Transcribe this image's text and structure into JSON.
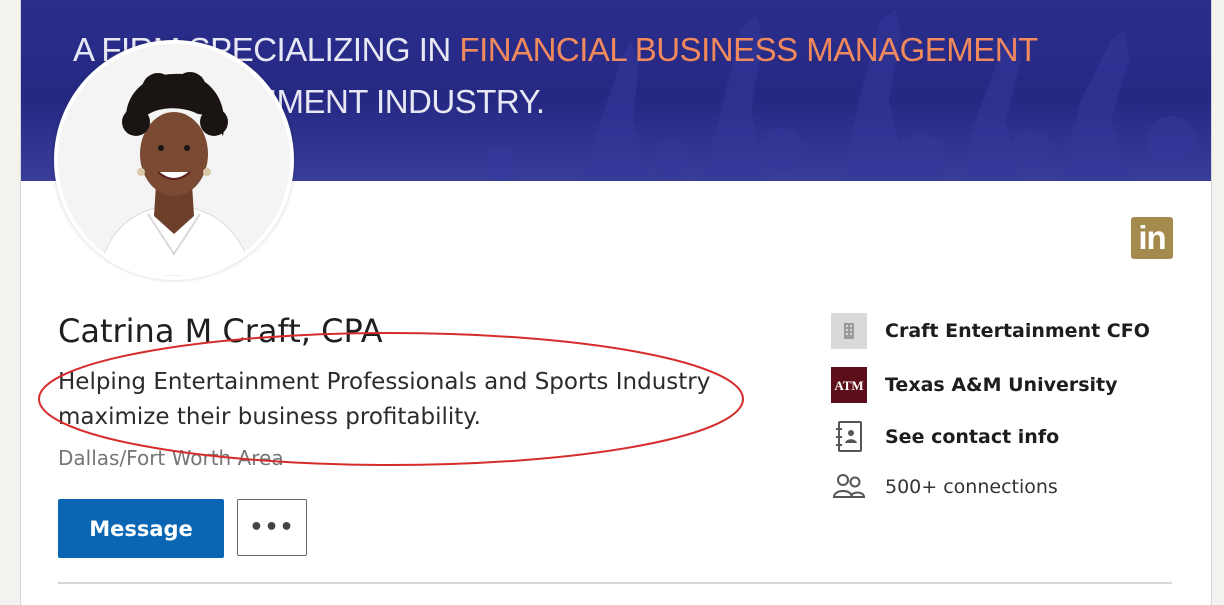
{
  "banner": {
    "line1_prefix": "A FIRM SPECIALIZING IN ",
    "line1_highlight": "FINANCIAL BUSINESS MANAGEMENT",
    "line2": "ENTERTAINMENT INDUSTRY.",
    "text_color": "#e8e8f4",
    "highlight_color": "#f08a5d",
    "background": "#2a2d8a"
  },
  "profile": {
    "name": "Catrina M Craft, CPA",
    "headline": "Helping Entertainment Professionals and Sports Industry maximize their business profitability.",
    "location": "Dallas/Fort Worth Area"
  },
  "actions": {
    "message_label": "Message",
    "more_label": "•••"
  },
  "sidebar": {
    "company": "Craft Entertainment CFO",
    "school": "Texas A&M University",
    "contact": "See contact info",
    "connections": "500+ connections"
  },
  "linkedin_badge": {
    "label": "in",
    "color": "#a48a4c"
  },
  "colors": {
    "primary_button": "#0a66b3",
    "annotation_ellipse": "#d62c2c",
    "school_logo": "#6b0f1a"
  }
}
